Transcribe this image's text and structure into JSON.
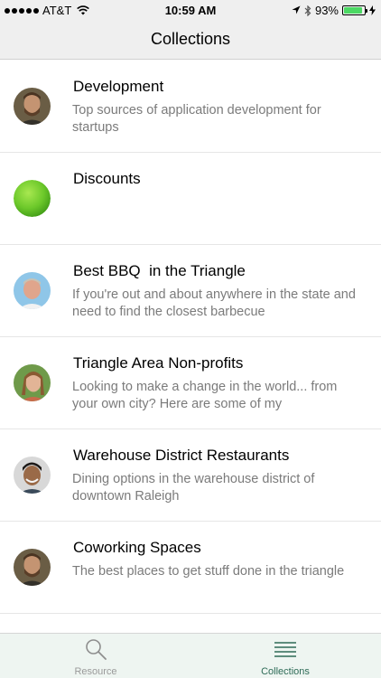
{
  "status_bar": {
    "carrier": "AT&T",
    "time": "10:59 AM",
    "battery": "93%",
    "battery_level": 0.93
  },
  "nav": {
    "title": "Collections"
  },
  "collections": [
    {
      "title": "Development",
      "description": "Top sources of application development for startups",
      "avatar": "person"
    },
    {
      "title": "Discounts",
      "description": "",
      "avatar": "green-ball"
    },
    {
      "title": "Best BBQ  in the Triangle",
      "description": "If you're out and about anywhere in the state and need to find the closest barbecue",
      "avatar": "person"
    },
    {
      "title": "Triangle Area Non-profits",
      "description": "Looking to make a change in the world... from your own city? Here are some of my",
      "avatar": "person"
    },
    {
      "title": "Warehouse District Restaurants",
      "description": "Dining options in the warehouse district of downtown Raleigh",
      "avatar": "person"
    },
    {
      "title": "Coworking Spaces",
      "description": "The best places to get stuff done in the triangle",
      "avatar": "person"
    }
  ],
  "tab_bar": {
    "resource_label": "Resource",
    "collections_label": "Collections"
  },
  "colors": {
    "accent": "#2e6b57",
    "tab_bar_bg": "#eef5f1",
    "battery_green": "#4cd964"
  }
}
